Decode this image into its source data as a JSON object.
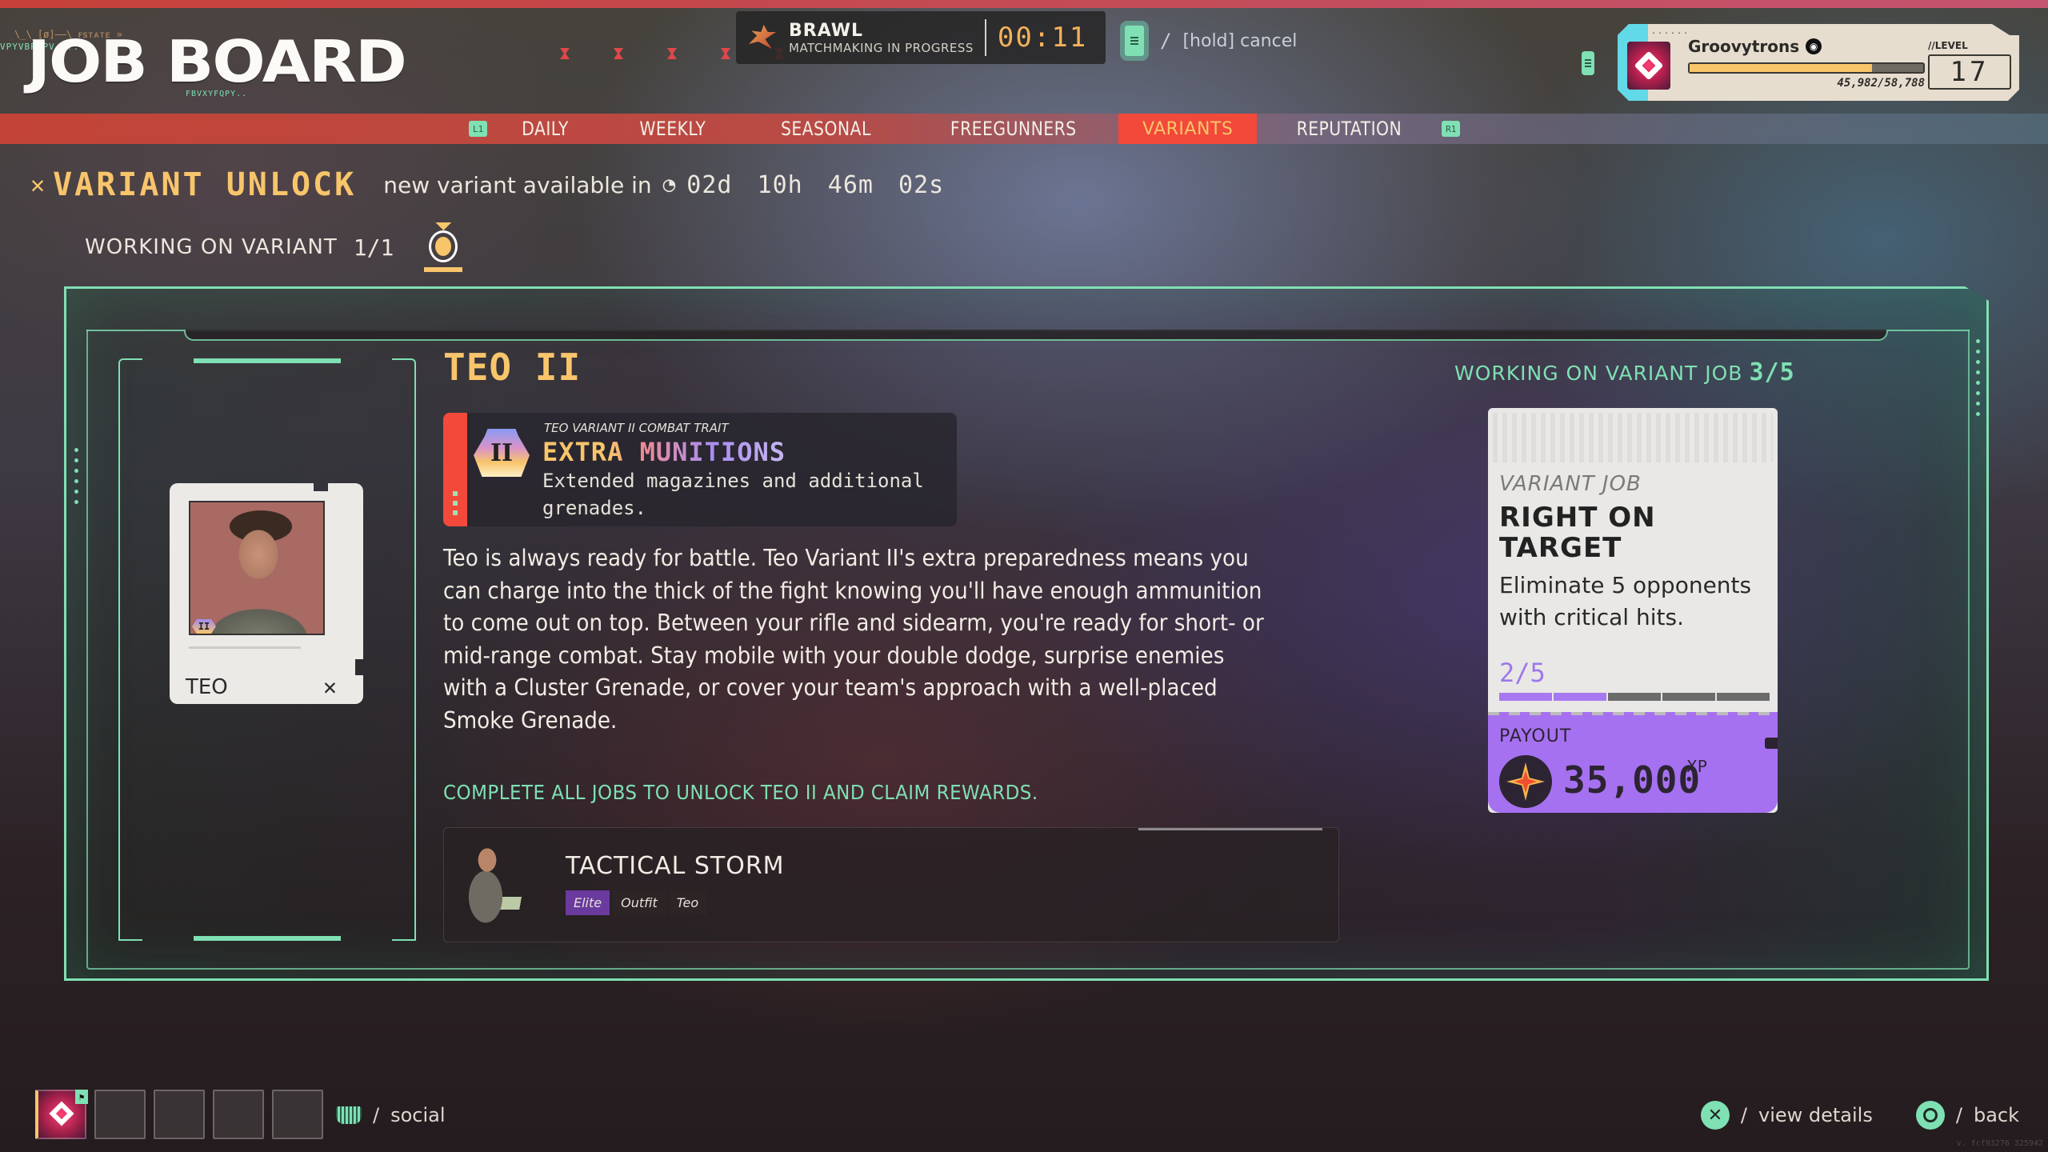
{
  "header": {
    "title": "JOB BOARD",
    "deco_top": "\\_\\_[ø]——\\_ꜰꜱᴛᴀᴛᴇ_»",
    "deco_green": "VPYVBPDPV....",
    "deco_bottom": "FBVXYFQPY.."
  },
  "matchmaking": {
    "mode": "BRAWL",
    "status": "MATCHMAKING IN PROGRESS",
    "timer": "00:11",
    "cancel_separator": "/",
    "cancel_label": "[hold] cancel"
  },
  "profile": {
    "name": "Groovytrons",
    "platform_icon": "playstation-icon",
    "xp_current": 45982,
    "xp_max": 58788,
    "xp_text": "45,982/58,788",
    "xp_fraction": 0.782,
    "level_label": "//LEVEL",
    "level": "17",
    "dots": "......"
  },
  "tabs": {
    "left_bumper": "L1",
    "right_bumper": "R1",
    "items": [
      {
        "label": "DAILY",
        "active": false
      },
      {
        "label": "WEEKLY",
        "active": false
      },
      {
        "label": "SEASONAL",
        "active": false
      },
      {
        "label": "FREEGUNNERS",
        "active": false
      },
      {
        "label": "VARIANTS",
        "active": true
      },
      {
        "label": "REPUTATION",
        "active": false
      }
    ]
  },
  "section": {
    "icon": "variant-unlock-icon",
    "title": "VARIANT UNLOCK",
    "timer_label": "new variant available in",
    "timer_icon": "clock-icon",
    "timer_value": "02d 10h 46m 02s",
    "working_label": "WORKING ON VARIANT",
    "working_count": "1/1"
  },
  "hero_card": {
    "name": "TEO",
    "badge": "II",
    "class_icon": "assault-class-icon"
  },
  "variant": {
    "title": "TEO II",
    "trait": {
      "badge": "II",
      "subtitle": "TEO VARIANT II COMBAT TRAIT",
      "name": "EXTRA MUNITIONS",
      "description": "Extended magazines and additional grenades."
    },
    "bio": "Teo is always ready for battle. Teo Variant II's extra preparedness means you can charge into the thick of the fight knowing you'll have enough ammunition to come out on top. Between your rifle and sidearm, you're ready for short- or mid-range combat. Stay mobile with your double dodge, surprise enemies with a Cluster Grenade, or cover your team's approach with a well-placed Smoke Grenade.",
    "unlock_note": "COMPLETE ALL JOBS TO UNLOCK TEO II AND CLAIM REWARDS.",
    "reward": {
      "name": "TACTICAL STORM",
      "tags": [
        "Elite",
        "Outfit",
        "Teo"
      ]
    }
  },
  "job": {
    "header_label": "WORKING ON VARIANT JOB",
    "header_count": "3/5",
    "type": "VARIANT JOB",
    "name": "RIGHT ON TARGET",
    "description": "Eliminate 5 opponents with critical hits.",
    "progress_text": "2/5",
    "progress_done": 2,
    "progress_total": 5,
    "payout_label": "PAYOUT",
    "payout_value": "35,000",
    "payout_unit": "XP"
  },
  "footer": {
    "party_slots": 5,
    "social_separator": "/",
    "social_label": "social",
    "view_details_separator": "/",
    "view_details_label": "view details",
    "back_separator": "/",
    "back_label": "back",
    "version": "v. fcf93276 325942"
  },
  "colors": {
    "accent_green": "#7fe0b3",
    "accent_gold": "#f8c56b",
    "tab_red": "#f2493a",
    "payout_purple": "#a671f0"
  }
}
